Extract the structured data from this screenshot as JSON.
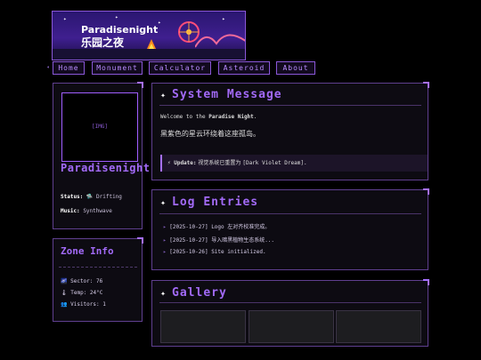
{
  "banner": {
    "title_line1": "Paradisenight",
    "title_line2": "乐园之夜"
  },
  "nav": {
    "items": [
      "Home",
      "Monument",
      "Calculator",
      "Asteroid",
      "About"
    ]
  },
  "profile": {
    "avatar_placeholder": "[IMG]",
    "username": "Paradisenight",
    "status_label": "Status:",
    "status_value": "🛸 Drifting",
    "music_label": "Music:",
    "music_value": "Synthwave"
  },
  "zone": {
    "title": "Zone Info",
    "items": [
      {
        "icon": "🌌",
        "text": "Sector: 76"
      },
      {
        "icon": "🌡",
        "text": "Temp: 24°C"
      },
      {
        "icon": "👥",
        "text": "Visitors: 1"
      }
    ]
  },
  "system": {
    "title": "System Message",
    "welcome_prefix": "Welcome to the",
    "welcome_name": "Paradise Night",
    "welcome_suffix": ".",
    "message": "黑紫色的星云环绕着这座孤岛。",
    "update_label": "⚡ Update:",
    "update_text": " 视觉系统已重置为 ",
    "update_value": "[Dark Violet Dream]",
    "update_end": "."
  },
  "log": {
    "title": "Log Entries",
    "entries": [
      "[2025-10-27] Logo 左对齐校准完成。",
      "[2025-10-27] 导入暗黑植物生态系统...",
      "[2025-10-26] Site initialized."
    ]
  },
  "gallery": {
    "title": "Gallery"
  },
  "colors": {
    "accent": "#a26af7",
    "border": "#5f3f8f",
    "background": "#000000"
  }
}
